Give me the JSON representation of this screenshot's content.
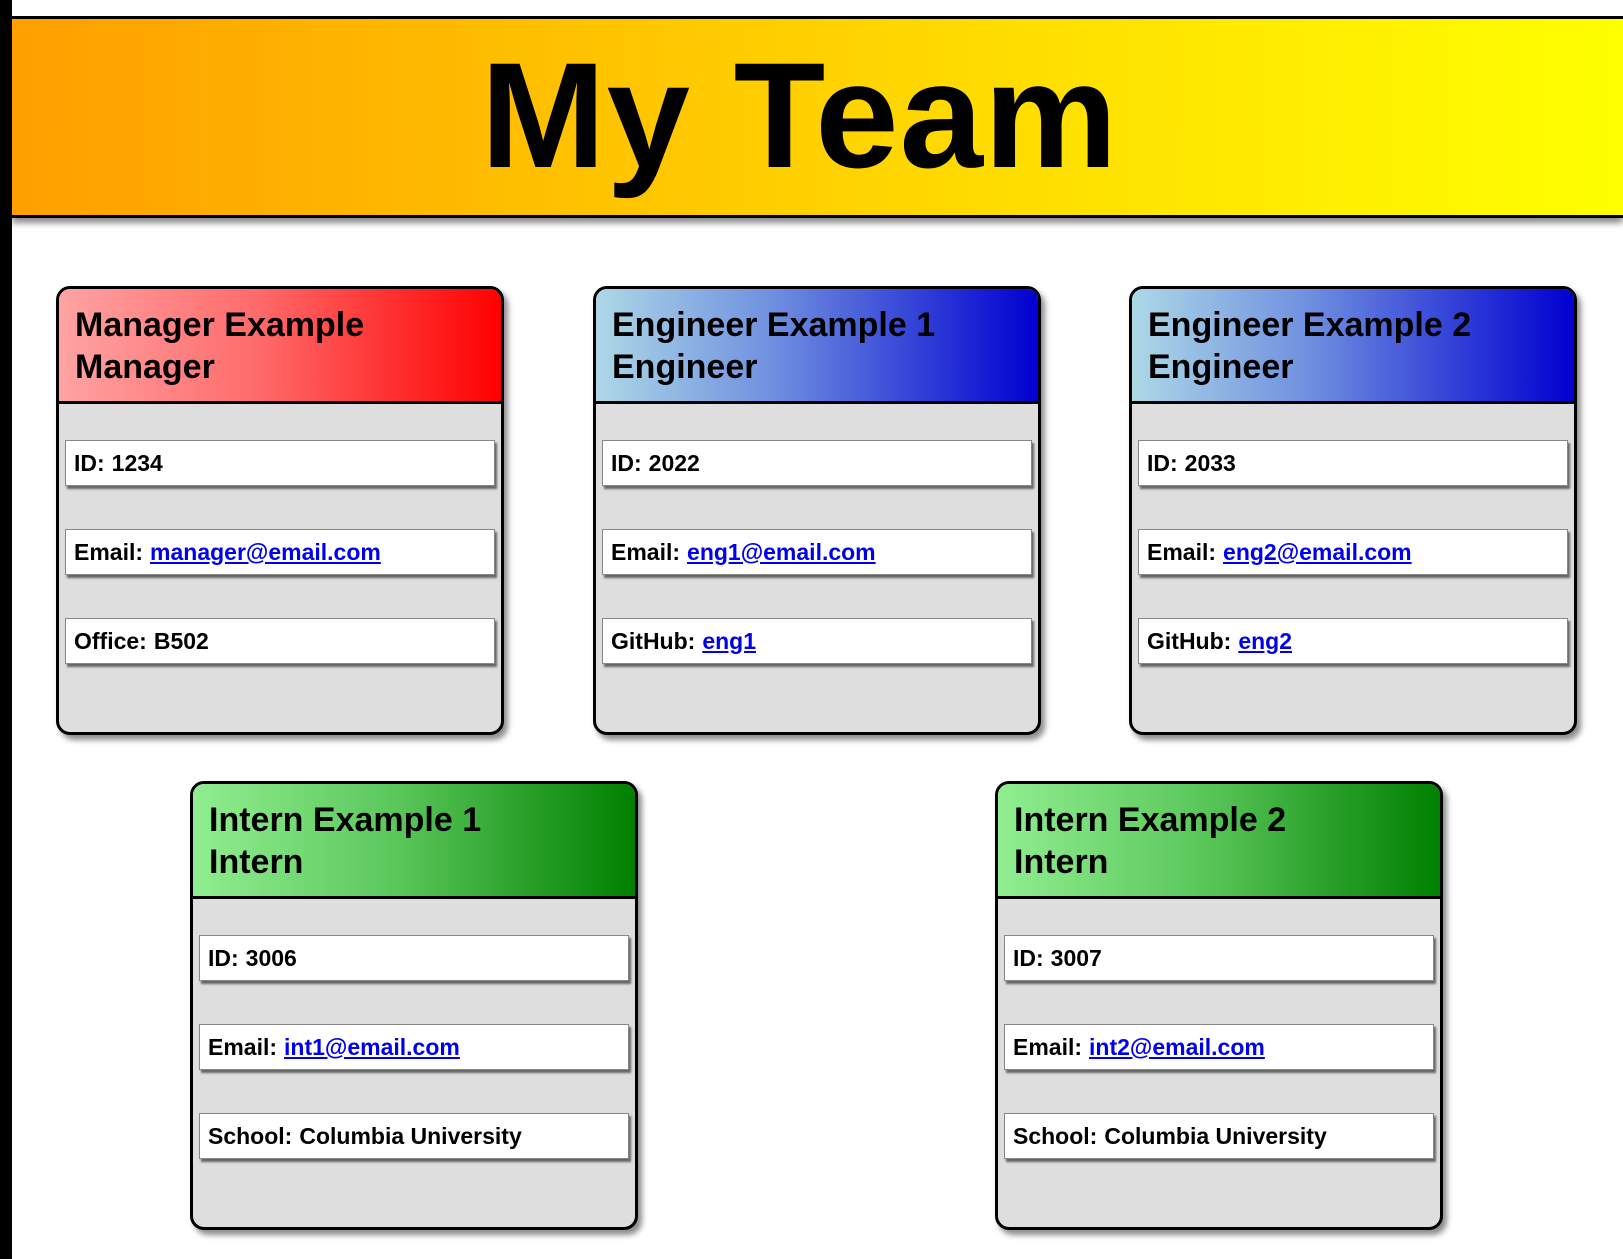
{
  "page": {
    "title": "My Team"
  },
  "colors": {
    "banner_gradient": [
      "#ff9f00",
      "#ffff00"
    ],
    "manager_gradient": [
      "#ffa3a3",
      "#ff0000"
    ],
    "engineer_gradient": [
      "#add8e6",
      "#0000d0"
    ],
    "intern_gradient": [
      "#90ee90",
      "#008000"
    ],
    "card_body": "#dedede",
    "link": "#0000ee"
  },
  "cards": [
    {
      "name": "Manager Example",
      "role": "Manager",
      "id_label": "ID:",
      "id": "1234",
      "email_label": "Email:",
      "email": "manager@email.com",
      "extra_label": "Office:",
      "extra": "B502"
    },
    {
      "name": "Engineer Example 1",
      "role": "Engineer",
      "id_label": "ID:",
      "id": "2022",
      "email_label": "Email:",
      "email": "eng1@email.com",
      "extra_label": "GitHub:",
      "extra": "eng1"
    },
    {
      "name": "Engineer Example 2",
      "role": "Engineer",
      "id_label": "ID:",
      "id": "2033",
      "email_label": "Email:",
      "email": "eng2@email.com",
      "extra_label": "GitHub:",
      "extra": "eng2"
    },
    {
      "name": "Intern Example 1",
      "role": "Intern",
      "id_label": "ID:",
      "id": "3006",
      "email_label": "Email:",
      "email": "int1@email.com",
      "extra_label": "School:",
      "extra": "Columbia University"
    },
    {
      "name": "Intern Example 2",
      "role": "Intern",
      "id_label": "ID:",
      "id": "3007",
      "email_label": "Email:",
      "email": "int2@email.com",
      "extra_label": "School:",
      "extra": "Columbia University"
    }
  ]
}
